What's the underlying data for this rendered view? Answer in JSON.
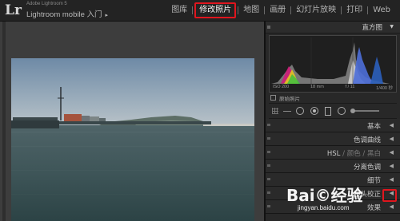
{
  "app": {
    "logo_text": "Lr",
    "subtitle": "Adobe Lightroom 5",
    "title": "Lightroom mobile 入门",
    "title_arrow": "▸"
  },
  "modules": [
    {
      "label": "图库",
      "active": false
    },
    {
      "label": "修改照片",
      "active": true
    },
    {
      "label": "地图",
      "active": false
    },
    {
      "label": "画册",
      "active": false
    },
    {
      "label": "幻灯片放映",
      "active": false
    },
    {
      "label": "打印",
      "active": false
    },
    {
      "label": "Web",
      "active": false
    }
  ],
  "histogram": {
    "title": "直方图",
    "collapse_icon": "▼",
    "iso": "ISO 200",
    "focal": "18 mm",
    "aperture": "f / 11",
    "shutter": "1/400 秒",
    "original_photo": "原始照片"
  },
  "sections": [
    {
      "label": "基本",
      "arrow": "◀"
    },
    {
      "label": "色调曲线",
      "arrow": "◀"
    },
    {
      "label": "HSL",
      "label_b": "颜色",
      "label_c": "黑白",
      "arrow": "◀"
    },
    {
      "label": "分离色调",
      "arrow": "◀"
    },
    {
      "label": "细节",
      "arrow": "◀"
    },
    {
      "label": "镜头校正",
      "arrow": "◀"
    },
    {
      "label": "效果",
      "arrow": "◀"
    }
  ],
  "watermark": {
    "logo": "Bai©经验",
    "url": "jingyan.baidu.com"
  },
  "colors": {
    "accent_red": "#e0161e",
    "panel_bg": "#282828",
    "workspace_bg": "#3d3d3d"
  }
}
